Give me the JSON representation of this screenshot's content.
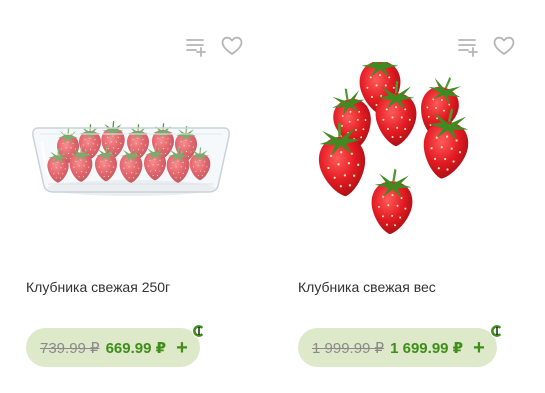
{
  "products": [
    {
      "title": "Клубника свежая 250г",
      "old_price": "739.99 ₽",
      "new_price": "669.99 ₽",
      "add_symbol": "+"
    },
    {
      "title": "Клубника свежая вес",
      "old_price": "1 999.99 ₽",
      "new_price": "1 699.99 ₽",
      "add_symbol": "+"
    }
  ],
  "icons": {
    "add_to_list": "playlist-add-icon",
    "favorite": "heart-outline-icon",
    "badge": "green-c-badge-icon"
  },
  "colors": {
    "price_green": "#3e8e19",
    "pill_background": "#dde9c9",
    "old_price_gray": "#8a8a8a",
    "icon_gray": "#b5b5b5"
  }
}
